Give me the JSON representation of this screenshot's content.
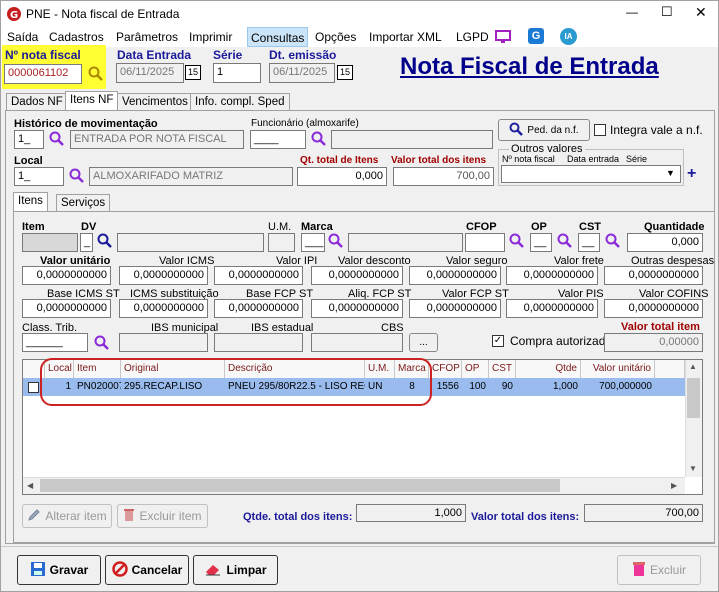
{
  "window": {
    "title": "PNE - Nota fiscal de Entrada",
    "minimize": "—",
    "maximize": "☐",
    "close": "✕"
  },
  "menu": [
    "Saída",
    "Cadastros",
    "Parâmetros",
    "Imprimir",
    "Consultas",
    "Opções",
    "Importar XML",
    "LGPD"
  ],
  "menu_badges": {
    "g": "G",
    "ia": "IA"
  },
  "header": {
    "nota_label": "Nº nota fiscal",
    "nota_value": "0000061102",
    "data_entrada_label": "Data Entrada",
    "data_entrada_value": "06/11/2025",
    "serie_label": "Série",
    "serie_value": "1",
    "dt_emissao_label": "Dt. emissão",
    "dt_emissao_value": "06/11/2025",
    "calendar_label": "15",
    "big_title": "Nota Fiscal de Entrada"
  },
  "tabs": [
    "Dados NF",
    "Itens NF",
    "Vencimentos",
    "Info. compl. Sped"
  ],
  "itens_nf": {
    "hist_label": "Histórico de movimentação",
    "hist_code": "1_",
    "hist_desc": "ENTRADA POR NOTA FISCAL",
    "func_label": "Funcionário (almoxarife)",
    "func_code": "____",
    "ped_button": "Ped. da n.f.",
    "integra_label": "Integra vale a n.f.",
    "local_label": "Local",
    "local_code": "1_",
    "local_desc": "ALMOXARIFADO MATRIZ",
    "qt_total_label": "Qt. total de Itens",
    "qt_total_value": "0,000",
    "valor_total_label": "Valor total dos itens",
    "valor_total_value": "700,00",
    "outros_valores_label": "Outros valores",
    "nota_fiscal_col": "Nº nota fiscal",
    "data_entrada_col": "Data entrada",
    "serie_col": "Série",
    "plus": "+"
  },
  "subtabs": [
    "Itens",
    "Serviços"
  ],
  "item_form": {
    "item_label": "Item",
    "dv_label": "DV",
    "dv_value": "_",
    "um_label": "U.M.",
    "marca_label": "Marca",
    "marca_value": "___",
    "cfop_label": "CFOP",
    "op_label": "OP",
    "op_value": "__",
    "cst_label": "CST",
    "cst_value": "__",
    "quantidade_label": "Quantidade",
    "quantidade_value": "0,000",
    "row2_labels": [
      "Valor unitário",
      "Valor ICMS",
      "Valor IPI",
      "Valor desconto",
      "Valor seguro",
      "Valor frete",
      "Outras despesas"
    ],
    "row2_values": [
      "0,0000000000",
      "0,0000000000",
      "0,0000000000",
      "0,0000000000",
      "0,0000000000",
      "0,0000000000",
      "0,0000000000"
    ],
    "row3_labels": [
      "Base ICMS ST",
      "ICMS substituição",
      "Base FCP ST",
      "Aliq. FCP ST",
      "Valor FCP ST",
      "Valor PIS",
      "Valor COFINS"
    ],
    "row3_values": [
      "0,0000000000",
      "0,0000000000",
      "0,0000000000",
      "0,0000000000",
      "0,0000000000",
      "0,0000000000",
      "0,0000000000"
    ],
    "class_trib_label": "Class. Trib.",
    "class_trib_value": "______",
    "ibs_mun_label": "IBS municipal",
    "ibs_est_label": "IBS estadual",
    "cbs_label": "CBS",
    "ellipsis": "...",
    "compra_label": "Compra autorizada",
    "valor_total_item_label": "Valor total item",
    "valor_total_item_value": "0,00000"
  },
  "grid": {
    "columns": [
      "Local",
      "Item",
      "Original",
      "Descrição",
      "U.M.",
      "Marca",
      "CFOP",
      "OP",
      "CST",
      "Qtde",
      "Valor unitário"
    ],
    "rows": [
      [
        "1",
        "PN020007",
        "295.RECAP.LISO",
        "PNEU 295/80R22.5 - LISO REC...",
        "UN",
        "8",
        "1556",
        "100",
        "90",
        "1,000",
        "700,000000"
      ]
    ],
    "scroll_up": "▲",
    "scroll_down": "▼",
    "scroll_left": "◀",
    "scroll_right": "▶"
  },
  "grid_footer": {
    "alterar": "Alterar item",
    "excluir": "Excluir item",
    "qtde_total_label": "Qtde. total dos itens:",
    "qtde_total_value": "1,000",
    "valor_total_label": "Valor total dos itens:",
    "valor_total_value": "700,00"
  },
  "footer": {
    "gravar": "Gravar",
    "cancelar": "Cancelar",
    "limpar": "Limpar",
    "excluir": "Excluir"
  },
  "colors": {
    "accent": "#00008b",
    "highlight": "#ffff33",
    "selected_row": "#99bbee",
    "annotation": "#cc2222"
  }
}
